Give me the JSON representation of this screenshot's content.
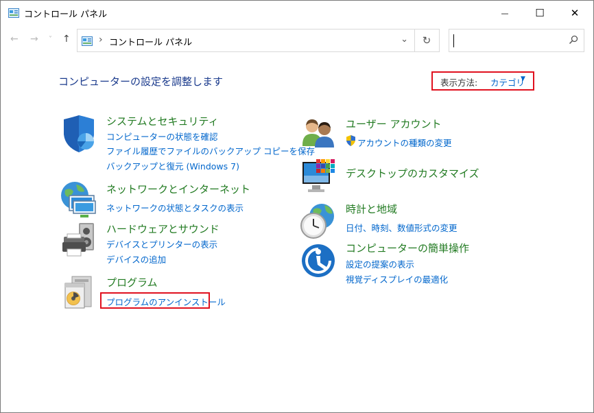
{
  "window": {
    "title": "コントロール パネル",
    "minimize": "—",
    "maximize": "☐",
    "close": "✕"
  },
  "nav": {
    "back": "←",
    "forward": "→",
    "recent": "˅",
    "up": "↑"
  },
  "address": {
    "separator": "›",
    "path": "コントロール パネル",
    "dropdown": "⌄",
    "refresh": "↻"
  },
  "search": {
    "placeholder": "",
    "icon": "⚲"
  },
  "main": {
    "heading": "コンピューターの設定を調整します",
    "view_by_label": "表示方法:",
    "view_by_value": "カテゴリ",
    "view_by_arrow": "▼"
  },
  "categories": {
    "security": {
      "title": "システムとセキュリティ",
      "links": [
        "コンピューターの状態を確認",
        "ファイル履歴でファイルのバックアップ コピーを保存",
        "バックアップと復元 (Windows 7)"
      ]
    },
    "network": {
      "title": "ネットワークとインターネット",
      "links": [
        "ネットワークの状態とタスクの表示"
      ]
    },
    "hardware": {
      "title": "ハードウェアとサウンド",
      "links": [
        "デバイスとプリンターの表示",
        "デバイスの追加"
      ]
    },
    "programs": {
      "title": "プログラム",
      "links": [
        "プログラムのアンインストール"
      ]
    },
    "users": {
      "title": "ユーザー アカウント",
      "links": [
        "アカウントの種類の変更"
      ]
    },
    "desktop": {
      "title": "デスクトップのカスタマイズ",
      "links": []
    },
    "clock": {
      "title": "時計と地域",
      "links": [
        "日付、時刻、数値形式の変更"
      ]
    },
    "ease": {
      "title": "コンピューターの簡単操作",
      "links": [
        "設定の提案の表示",
        "視覚ディスプレイの最適化"
      ]
    }
  }
}
